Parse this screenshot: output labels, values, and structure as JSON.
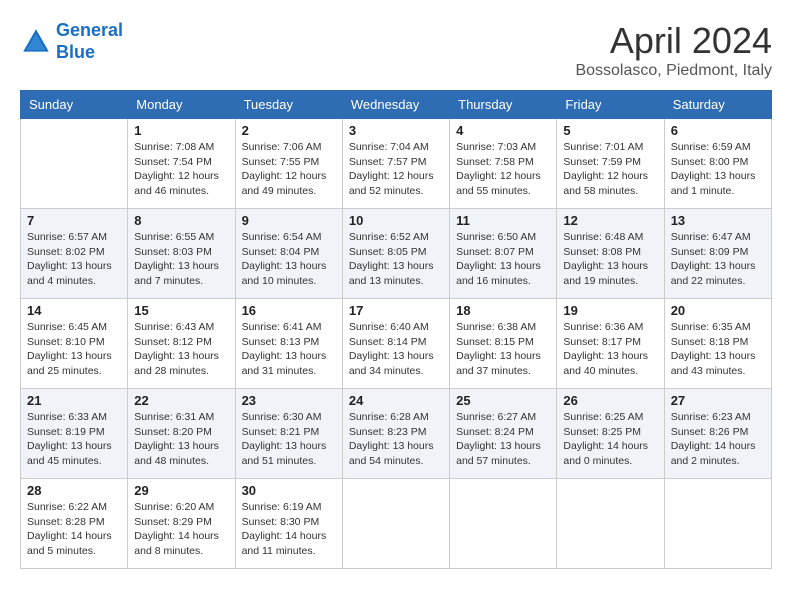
{
  "header": {
    "logo_line1": "General",
    "logo_line2": "Blue",
    "month": "April 2024",
    "location": "Bossolasco, Piedmont, Italy"
  },
  "weekdays": [
    "Sunday",
    "Monday",
    "Tuesday",
    "Wednesday",
    "Thursday",
    "Friday",
    "Saturday"
  ],
  "weeks": [
    [
      {
        "day": "",
        "info": ""
      },
      {
        "day": "1",
        "info": "Sunrise: 7:08 AM\nSunset: 7:54 PM\nDaylight: 12 hours\nand 46 minutes."
      },
      {
        "day": "2",
        "info": "Sunrise: 7:06 AM\nSunset: 7:55 PM\nDaylight: 12 hours\nand 49 minutes."
      },
      {
        "day": "3",
        "info": "Sunrise: 7:04 AM\nSunset: 7:57 PM\nDaylight: 12 hours\nand 52 minutes."
      },
      {
        "day": "4",
        "info": "Sunrise: 7:03 AM\nSunset: 7:58 PM\nDaylight: 12 hours\nand 55 minutes."
      },
      {
        "day": "5",
        "info": "Sunrise: 7:01 AM\nSunset: 7:59 PM\nDaylight: 12 hours\nand 58 minutes."
      },
      {
        "day": "6",
        "info": "Sunrise: 6:59 AM\nSunset: 8:00 PM\nDaylight: 13 hours\nand 1 minute."
      }
    ],
    [
      {
        "day": "7",
        "info": "Sunrise: 6:57 AM\nSunset: 8:02 PM\nDaylight: 13 hours\nand 4 minutes."
      },
      {
        "day": "8",
        "info": "Sunrise: 6:55 AM\nSunset: 8:03 PM\nDaylight: 13 hours\nand 7 minutes."
      },
      {
        "day": "9",
        "info": "Sunrise: 6:54 AM\nSunset: 8:04 PM\nDaylight: 13 hours\nand 10 minutes."
      },
      {
        "day": "10",
        "info": "Sunrise: 6:52 AM\nSunset: 8:05 PM\nDaylight: 13 hours\nand 13 minutes."
      },
      {
        "day": "11",
        "info": "Sunrise: 6:50 AM\nSunset: 8:07 PM\nDaylight: 13 hours\nand 16 minutes."
      },
      {
        "day": "12",
        "info": "Sunrise: 6:48 AM\nSunset: 8:08 PM\nDaylight: 13 hours\nand 19 minutes."
      },
      {
        "day": "13",
        "info": "Sunrise: 6:47 AM\nSunset: 8:09 PM\nDaylight: 13 hours\nand 22 minutes."
      }
    ],
    [
      {
        "day": "14",
        "info": "Sunrise: 6:45 AM\nSunset: 8:10 PM\nDaylight: 13 hours\nand 25 minutes."
      },
      {
        "day": "15",
        "info": "Sunrise: 6:43 AM\nSunset: 8:12 PM\nDaylight: 13 hours\nand 28 minutes."
      },
      {
        "day": "16",
        "info": "Sunrise: 6:41 AM\nSunset: 8:13 PM\nDaylight: 13 hours\nand 31 minutes."
      },
      {
        "day": "17",
        "info": "Sunrise: 6:40 AM\nSunset: 8:14 PM\nDaylight: 13 hours\nand 34 minutes."
      },
      {
        "day": "18",
        "info": "Sunrise: 6:38 AM\nSunset: 8:15 PM\nDaylight: 13 hours\nand 37 minutes."
      },
      {
        "day": "19",
        "info": "Sunrise: 6:36 AM\nSunset: 8:17 PM\nDaylight: 13 hours\nand 40 minutes."
      },
      {
        "day": "20",
        "info": "Sunrise: 6:35 AM\nSunset: 8:18 PM\nDaylight: 13 hours\nand 43 minutes."
      }
    ],
    [
      {
        "day": "21",
        "info": "Sunrise: 6:33 AM\nSunset: 8:19 PM\nDaylight: 13 hours\nand 45 minutes."
      },
      {
        "day": "22",
        "info": "Sunrise: 6:31 AM\nSunset: 8:20 PM\nDaylight: 13 hours\nand 48 minutes."
      },
      {
        "day": "23",
        "info": "Sunrise: 6:30 AM\nSunset: 8:21 PM\nDaylight: 13 hours\nand 51 minutes."
      },
      {
        "day": "24",
        "info": "Sunrise: 6:28 AM\nSunset: 8:23 PM\nDaylight: 13 hours\nand 54 minutes."
      },
      {
        "day": "25",
        "info": "Sunrise: 6:27 AM\nSunset: 8:24 PM\nDaylight: 13 hours\nand 57 minutes."
      },
      {
        "day": "26",
        "info": "Sunrise: 6:25 AM\nSunset: 8:25 PM\nDaylight: 14 hours\nand 0 minutes."
      },
      {
        "day": "27",
        "info": "Sunrise: 6:23 AM\nSunset: 8:26 PM\nDaylight: 14 hours\nand 2 minutes."
      }
    ],
    [
      {
        "day": "28",
        "info": "Sunrise: 6:22 AM\nSunset: 8:28 PM\nDaylight: 14 hours\nand 5 minutes."
      },
      {
        "day": "29",
        "info": "Sunrise: 6:20 AM\nSunset: 8:29 PM\nDaylight: 14 hours\nand 8 minutes."
      },
      {
        "day": "30",
        "info": "Sunrise: 6:19 AM\nSunset: 8:30 PM\nDaylight: 14 hours\nand 11 minutes."
      },
      {
        "day": "",
        "info": ""
      },
      {
        "day": "",
        "info": ""
      },
      {
        "day": "",
        "info": ""
      },
      {
        "day": "",
        "info": ""
      }
    ]
  ]
}
